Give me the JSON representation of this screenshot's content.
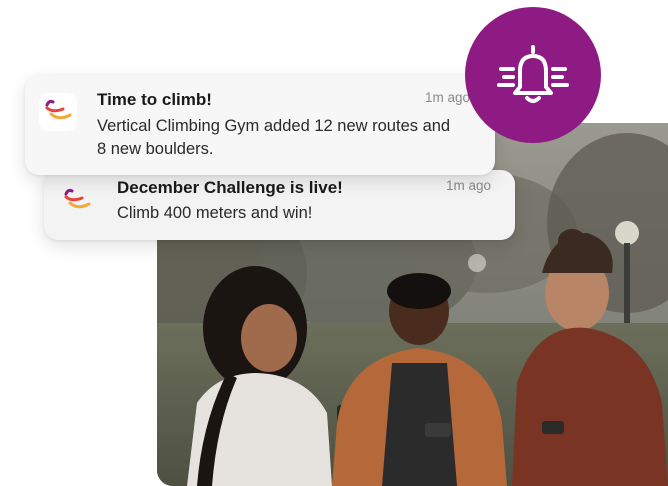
{
  "notifications": [
    {
      "title": "Time to climb!",
      "body": "Vertical Climbing Gym added 12 new routes and 8 new boulders.",
      "time": "1m ago",
      "icon": "climber-icon"
    },
    {
      "title": "December Challenge is live!",
      "body": "Climb 400 meters and win!",
      "time": "1m ago",
      "icon": "climber-icon"
    }
  ],
  "badge": {
    "icon": "bell-icon",
    "color": "#8e1a84"
  },
  "photo": {
    "subject": "people-with-phones-photo"
  }
}
